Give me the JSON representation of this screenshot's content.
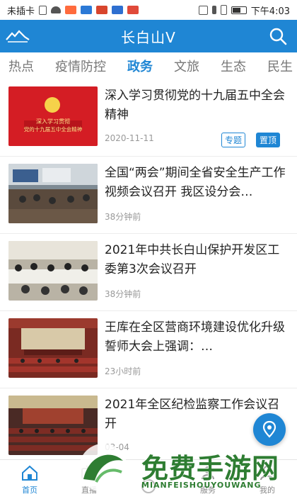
{
  "status_bar": {
    "carrier": "未插卡",
    "time": "下午4:03"
  },
  "header": {
    "title": "长白山V"
  },
  "tabs": [
    {
      "label": "热点",
      "active": false
    },
    {
      "label": "疫情防控",
      "active": false
    },
    {
      "label": "政务",
      "active": true
    },
    {
      "label": "文旅",
      "active": false
    },
    {
      "label": "生态",
      "active": false
    },
    {
      "label": "民生",
      "active": false
    }
  ],
  "news": [
    {
      "title": "深入学习贯彻党的十九届五中全会精神",
      "time": "2020-11-11",
      "tag": "专题",
      "pin": "置顶",
      "thumb_caption": "深入学习贯彻 党的十九届五中全会精神"
    },
    {
      "title": "全国“两会”期间全省安全生产工作视频会议召开 我区设分会…",
      "time": "38分钟前"
    },
    {
      "title": "2021年中共长白山保护开发区工委第3次会议召开",
      "time": "38分钟前"
    },
    {
      "title": "王库在全区营商环境建设优化升级誓师大会上强调：…",
      "time": "23小时前"
    },
    {
      "title": "2021年全区纪检监察工作会议召开",
      "time": "03-04"
    }
  ],
  "bottom_nav": [
    {
      "label": "首页",
      "icon": "home-icon",
      "active": true
    },
    {
      "label": "直播",
      "icon": "tv-icon",
      "active": false
    },
    {
      "label": "",
      "icon": "center-icon",
      "active": false
    },
    {
      "label": "服务",
      "icon": "service-icon",
      "active": false
    },
    {
      "label": "我的",
      "icon": "user-icon",
      "active": false
    }
  ],
  "watermark": {
    "text": "免费手游网",
    "sub": "MIANFEISHOUYOUWANG"
  },
  "colors": {
    "brand": "#1f86d4",
    "pin_tag": "#1f86d4"
  }
}
